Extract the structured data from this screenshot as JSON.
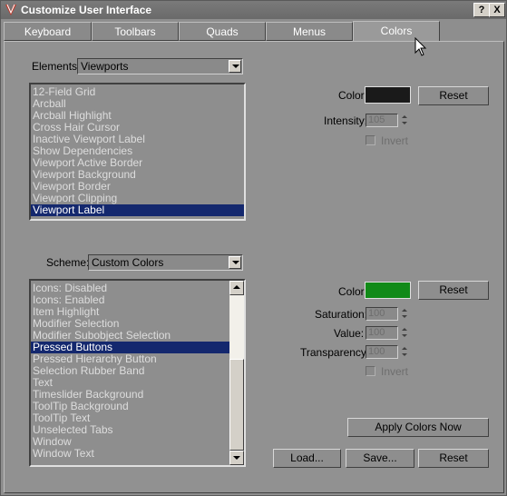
{
  "window": {
    "title": "Customize User Interface",
    "help_label": "?",
    "close_label": "X"
  },
  "tabs": [
    "Keyboard",
    "Toolbars",
    "Quads",
    "Menus",
    "Colors"
  ],
  "elements": {
    "label": "Elements:",
    "selected": "Viewports",
    "items": [
      "12-Field Grid",
      "Arcball",
      "Arcball Highlight",
      "Cross Hair Cursor",
      "Inactive Viewport Label",
      "Show Dependencies",
      "Viewport Active Border",
      "Viewport Background",
      "Viewport Border",
      "Viewport Clipping",
      "Viewport Label"
    ],
    "selected_item": "Viewport Label",
    "color_label": "Color:",
    "color_value": "#1a1a1a",
    "reset_label": "Reset",
    "intensity_label": "Intensity:",
    "intensity_value": "105",
    "invert_label": "Invert"
  },
  "scheme": {
    "label": "Scheme:",
    "selected": "Custom Colors",
    "items": [
      "Icons: Disabled",
      "Icons: Enabled",
      "Item Highlight",
      "Modifier Selection",
      "Modifier Subobject Selection",
      "Pressed Buttons",
      "Pressed Hierarchy Button",
      "Selection Rubber Band",
      "Text",
      "Timeslider Background",
      "ToolTip Background",
      "ToolTip Text",
      "Unselected Tabs",
      "Window",
      "Window Text"
    ],
    "selected_item": "Pressed Buttons",
    "color_label": "Color:",
    "color_value": "#118a18",
    "reset_label": "Reset",
    "saturation_label": "Saturation:",
    "saturation_value": "100",
    "value_label": "Value:",
    "value_value": "100",
    "transparency_label": "Transparency:",
    "transparency_value": "100",
    "invert_label": "Invert"
  },
  "buttons": {
    "apply": "Apply Colors Now",
    "load": "Load...",
    "save": "Save...",
    "reset": "Reset"
  }
}
